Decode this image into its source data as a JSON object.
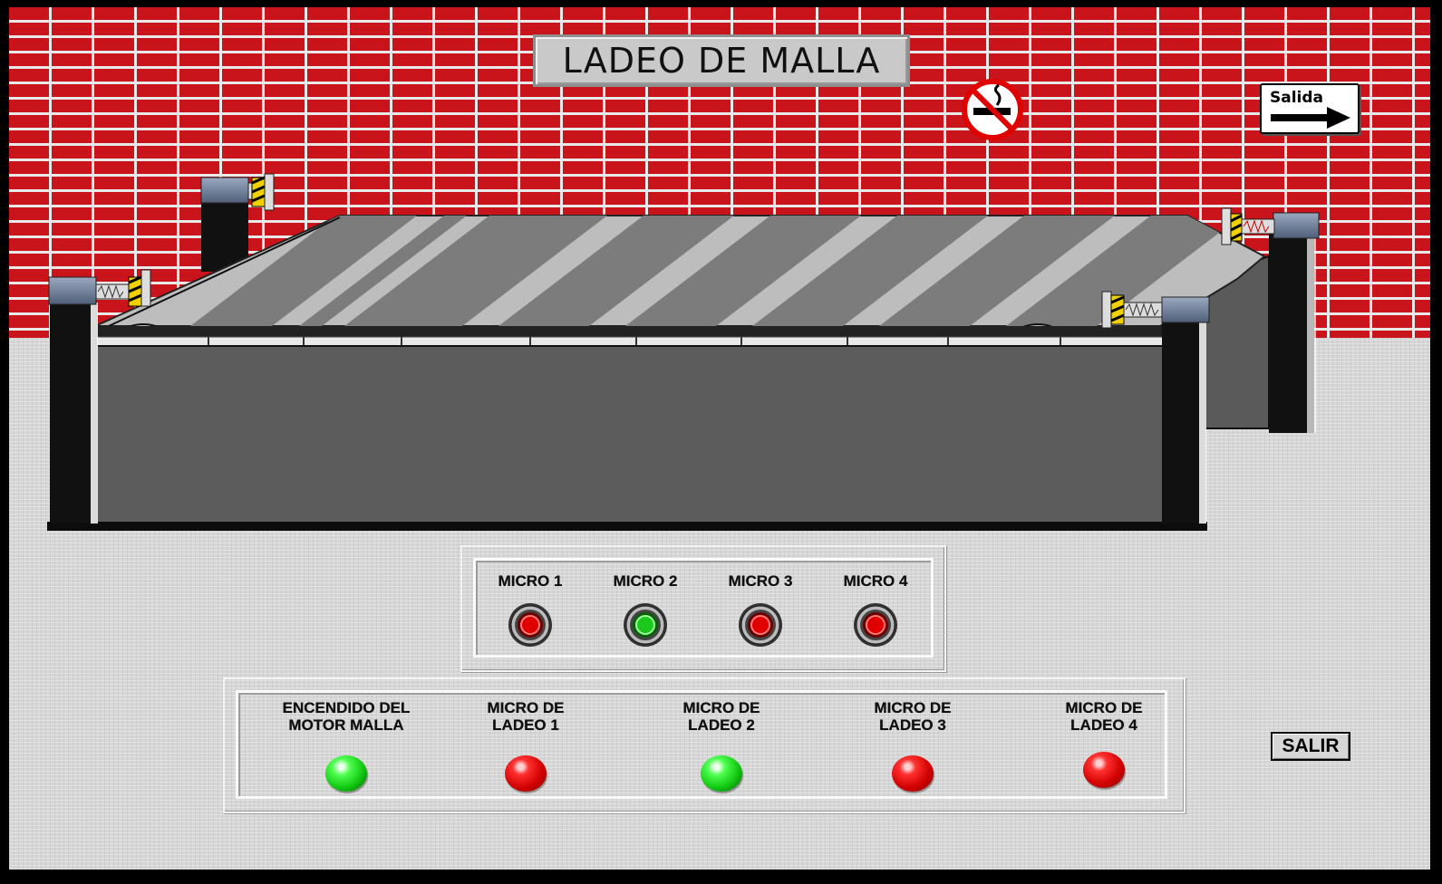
{
  "title": "LADEO DE MALLA",
  "signs": {
    "exit_label": "Salida",
    "exit_icon": "arrow-right-icon",
    "no_smoking_icon": "no-smoking-icon"
  },
  "micro_panel": {
    "items": [
      {
        "label": "MICRO 1",
        "state": "red"
      },
      {
        "label": "MICRO 2",
        "state": "green"
      },
      {
        "label": "MICRO 3",
        "state": "red"
      },
      {
        "label": "MICRO 4",
        "state": "red"
      }
    ]
  },
  "status_panel": {
    "items": [
      {
        "line1": "ENCENDIDO DEL",
        "line2": "MOTOR MALLA",
        "state": "green"
      },
      {
        "line1": "MICRO DE",
        "line2": "LADEO 1",
        "state": "red"
      },
      {
        "line1": "MICRO DE",
        "line2": "LADEO 2",
        "state": "green"
      },
      {
        "line1": "MICRO DE",
        "line2": "LADEO 3",
        "state": "red"
      },
      {
        "line1": "MICRO DE",
        "line2": "LADEO 4",
        "state": "red"
      }
    ]
  },
  "salir_label": "SALIR",
  "colors": {
    "brick": "#c8141a",
    "mortar": "#e9e9e9",
    "floor": "#d6d6d6",
    "lamp_red": "#e00000",
    "lamp_green": "#22dd22"
  }
}
